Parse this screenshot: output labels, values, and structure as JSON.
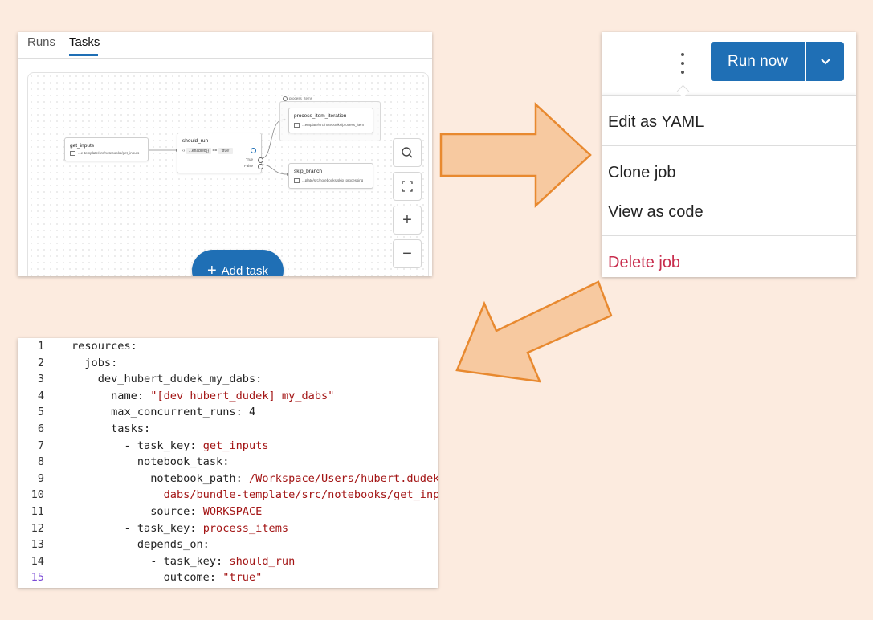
{
  "tasks_panel": {
    "tabs": [
      {
        "label": "Runs"
      },
      {
        "label": "Tasks"
      }
    ],
    "active_tab": "Tasks",
    "nodes": {
      "get_inputs": {
        "title": "get_inputs",
        "path": "...e-template/src/notebooks/get_inputs"
      },
      "should_run": {
        "title": "should_run",
        "condition_left": "...enabled}}",
        "operator": "==",
        "condition_right": "\"true\"",
        "true_label": "True",
        "false_label": "False"
      },
      "process_item_iteration": {
        "title": "process_item_iteration",
        "path": "...emplate/src/notebooks/process_item"
      },
      "skip_branch": {
        "title": "skip_branch",
        "path": "...plate/src/notebooks/skip_processing"
      }
    },
    "group_label": "process_items",
    "add_task_label": "Add task",
    "controls": {
      "search_icon": "search-icon",
      "fit_icon": "fit-screen-icon",
      "zoom_in": "+",
      "zoom_out": "−"
    }
  },
  "menu_panel": {
    "run_now_label": "Run now",
    "items": [
      {
        "label": "Edit as YAML"
      },
      {
        "label": "Clone job"
      },
      {
        "label": "View as code"
      },
      {
        "label": "Delete job"
      }
    ]
  },
  "code_panel": {
    "current_line": 15,
    "lines": [
      {
        "n": "1",
        "key": "resources:",
        "value": ""
      },
      {
        "n": "2",
        "key": "  jobs:",
        "value": ""
      },
      {
        "n": "3",
        "key": "    dev_hubert_dudek_my_dabs:",
        "value": ""
      },
      {
        "n": "4",
        "key": "      name: ",
        "value": "\"[dev hubert_dudek] my_dabs\""
      },
      {
        "n": "5",
        "key": "      max_concurrent_runs: 4",
        "value": ""
      },
      {
        "n": "6",
        "key": "      tasks:",
        "value": ""
      },
      {
        "n": "7",
        "key": "        - task_key: ",
        "value": "get_inputs"
      },
      {
        "n": "8",
        "key": "          notebook_task:",
        "value": ""
      },
      {
        "n": "9",
        "key": "            notebook_path: ",
        "value": "/Workspace/Users/hubert.dudek/"
      },
      {
        "n": "10",
        "key": "              ",
        "value": "dabs/bundle-template/src/notebooks/get_inputs"
      },
      {
        "n": "11",
        "key": "            source: ",
        "value": "WORKSPACE"
      },
      {
        "n": "12",
        "key": "        - task_key: ",
        "value": "process_items"
      },
      {
        "n": "13",
        "key": "          depends_on:",
        "value": ""
      },
      {
        "n": "14",
        "key": "            - task_key: ",
        "value": "should_run"
      },
      {
        "n": "15",
        "key": "              outcome: ",
        "value": "\"true\""
      }
    ]
  },
  "colors": {
    "background": "#fcebdf",
    "arrow_fill": "#f7c9a0",
    "arrow_stroke": "#e8892f",
    "primary": "#1f6fb5",
    "danger": "#c82d4d",
    "yaml_value": "#a31515"
  }
}
